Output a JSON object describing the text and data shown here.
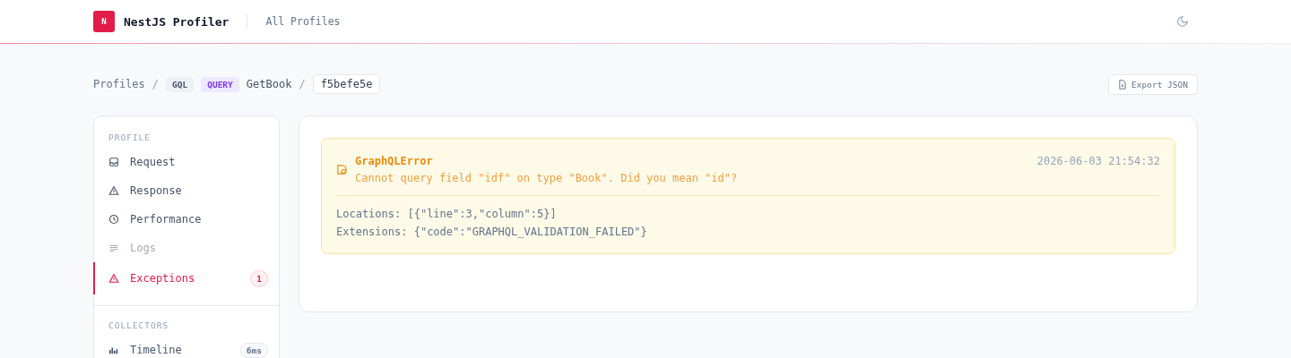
{
  "header": {
    "logo_letter": "N",
    "title": "NestJS Profiler",
    "nav_link": "All Profiles"
  },
  "breadcrumb": {
    "root": "Profiles",
    "separator": "/",
    "transport": "GQL",
    "operation_type": "QUERY",
    "operation_name": "GetBook",
    "separator_2": "/",
    "profile_id": "f5befe5e"
  },
  "export_button": "Export JSON",
  "sidebar": {
    "sections": [
      {
        "title": "PROFILE",
        "items": [
          {
            "label": "Request",
            "kind": "request",
            "selected": false,
            "disabled": false
          },
          {
            "label": "Response",
            "kind": "response",
            "selected": false,
            "disabled": false
          },
          {
            "label": "Performance",
            "kind": "performance",
            "selected": false,
            "disabled": false
          },
          {
            "label": "Logs",
            "kind": "logs",
            "selected": false,
            "disabled": true
          },
          {
            "label": "Exceptions",
            "kind": "exceptions",
            "selected": true,
            "disabled": false,
            "badge": "1"
          }
        ]
      },
      {
        "title": "COLLECTORS",
        "items": [
          {
            "label": "Timeline",
            "kind": "timeline",
            "selected": false,
            "disabled": false,
            "badge": "6ms"
          }
        ]
      }
    ]
  },
  "exception": {
    "name": "GraphQLError",
    "message": "Cannot query field \"idf\" on type \"Book\". Did you mean \"id\"?",
    "timestamp": "2026-06-03 21:54:32",
    "details": [
      "Locations: [{\"line\":3,\"column\":5}]",
      "Extensions: {\"code\":\"GRAPHQL_VALIDATION_FAILED\"}"
    ]
  }
}
